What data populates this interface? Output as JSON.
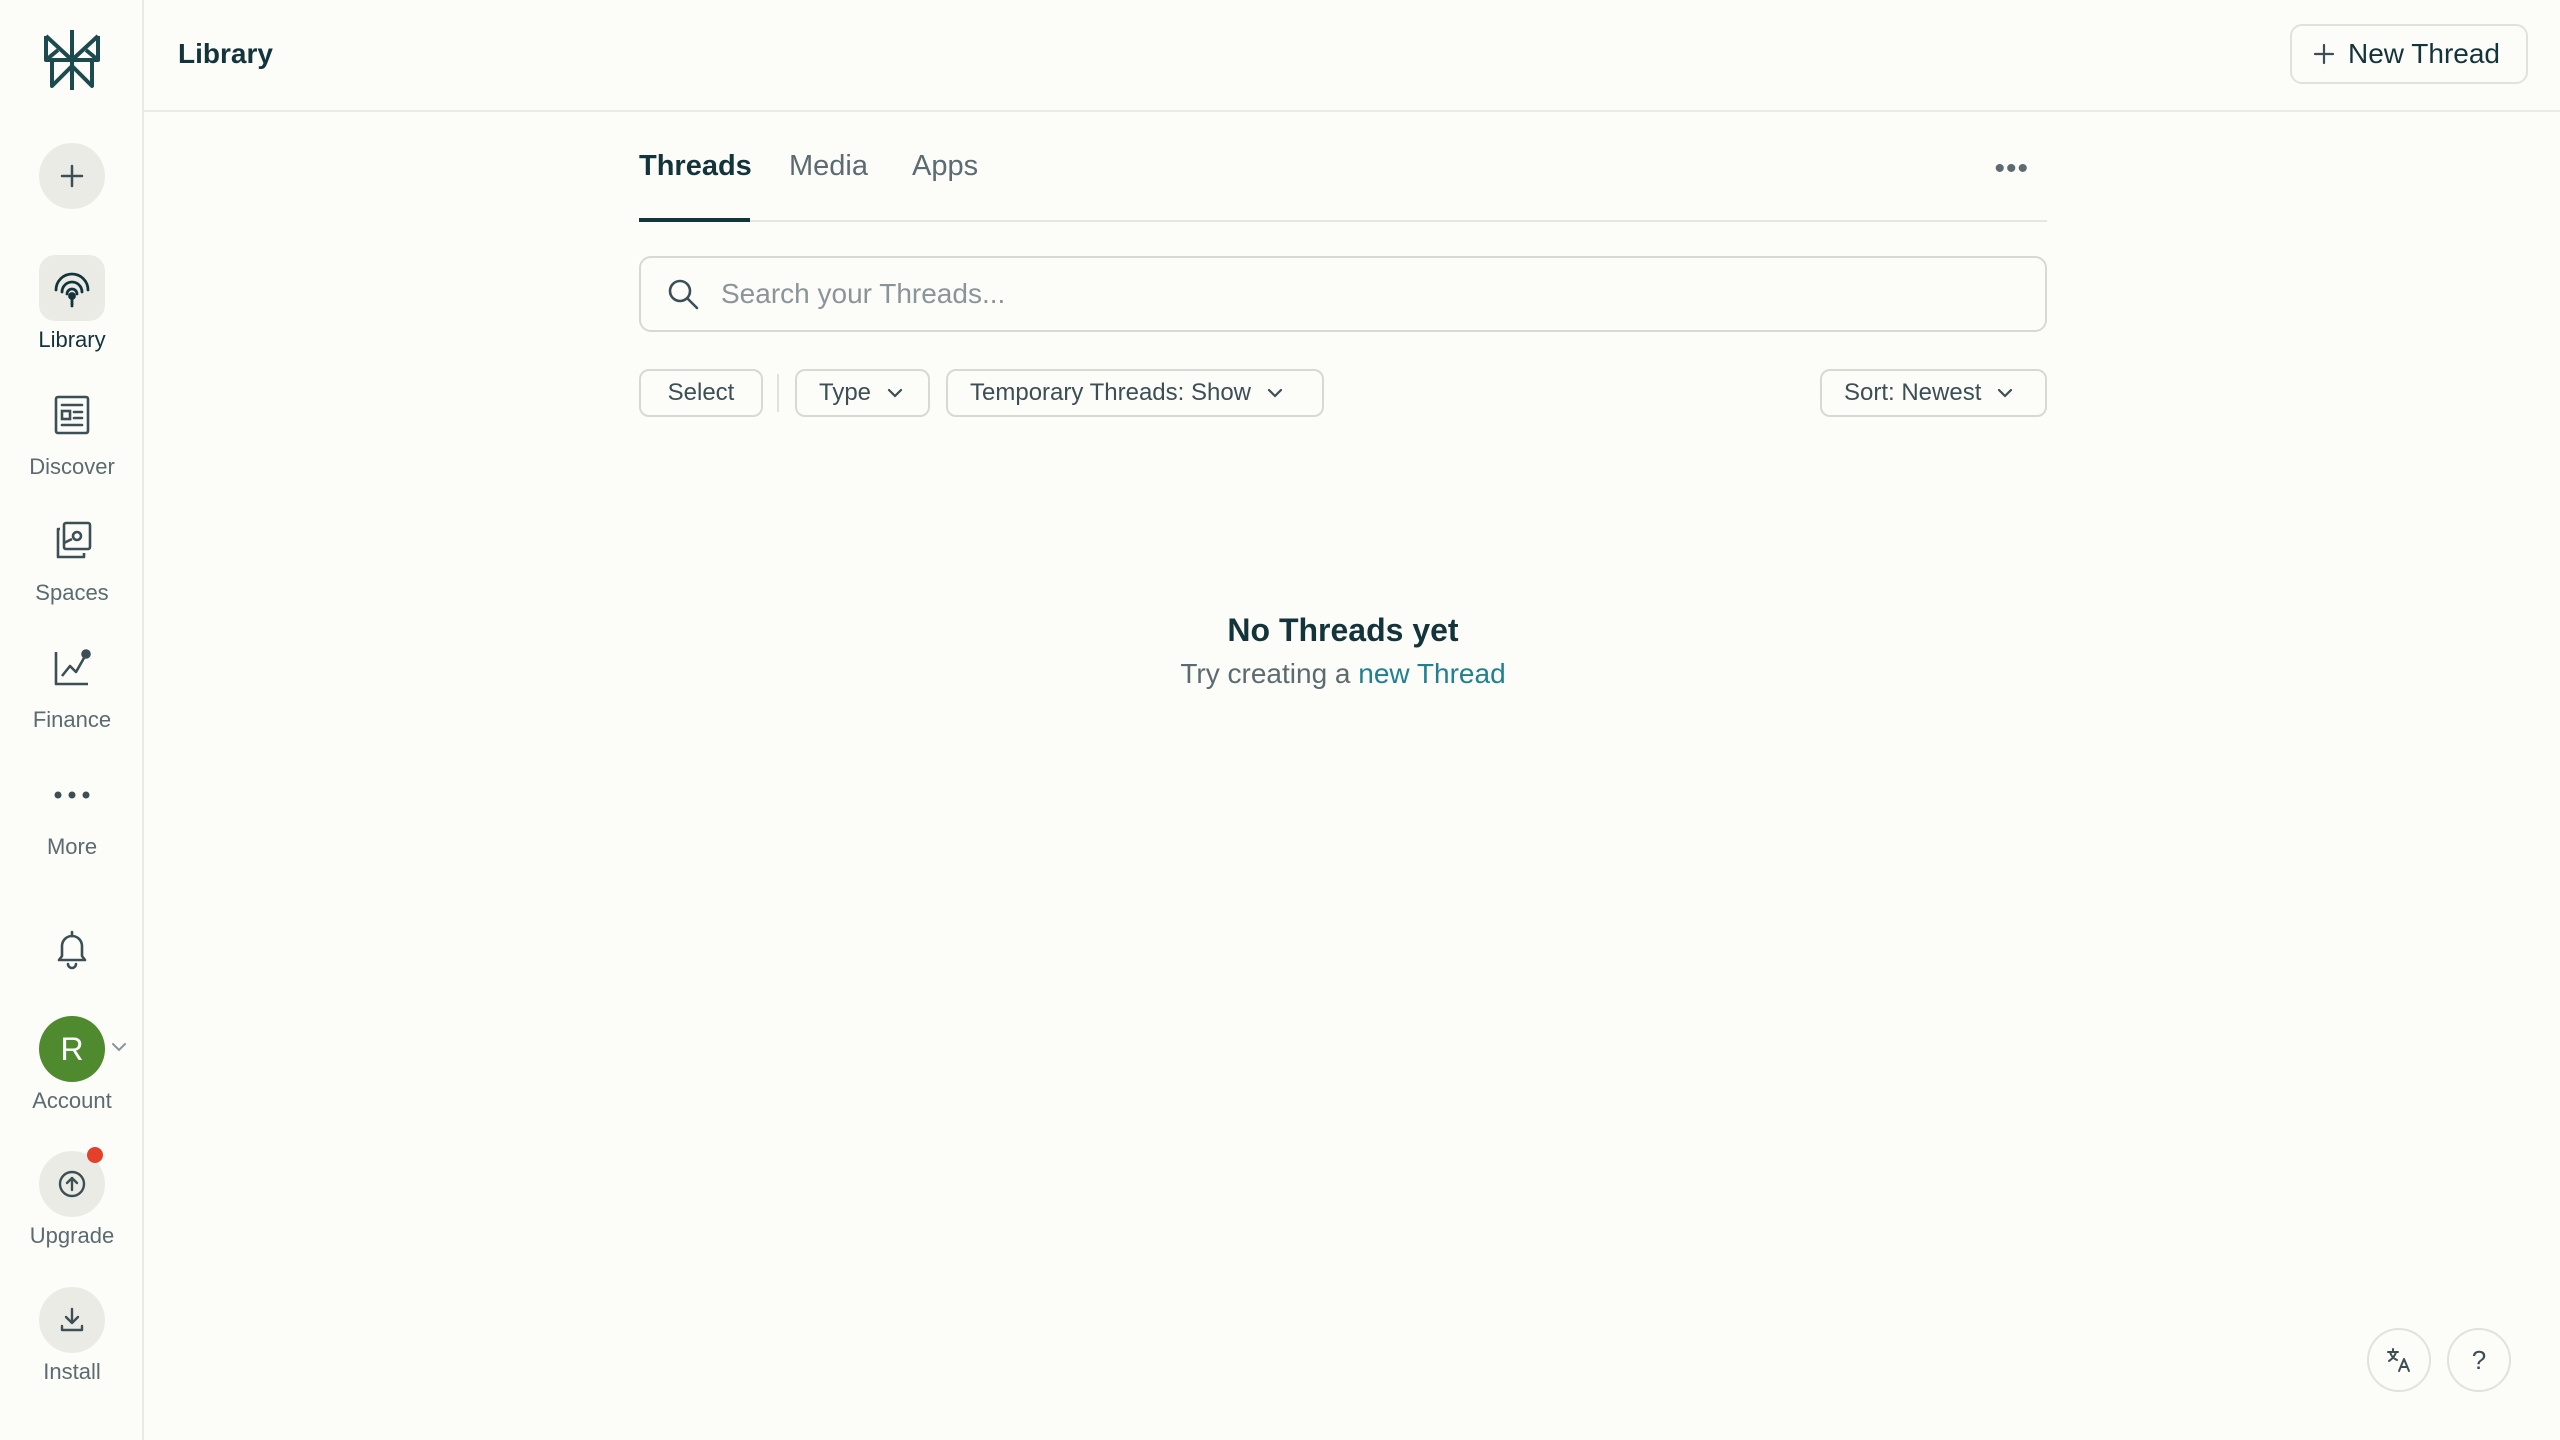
{
  "header": {
    "title": "Library",
    "new_thread_label": "New Thread"
  },
  "sidebar": {
    "items": [
      {
        "label": "Library",
        "icon": "library-icon",
        "active": true
      },
      {
        "label": "Discover",
        "icon": "discover-icon"
      },
      {
        "label": "Spaces",
        "icon": "spaces-icon"
      },
      {
        "label": "Finance",
        "icon": "finance-icon"
      },
      {
        "label": "More",
        "icon": "more-icon"
      }
    ],
    "account": {
      "initial": "R",
      "label": "Account"
    },
    "upgrade_label": "Upgrade",
    "install_label": "Install"
  },
  "tabs": [
    {
      "label": "Threads",
      "active": true
    },
    {
      "label": "Media"
    },
    {
      "label": "Apps"
    }
  ],
  "search": {
    "placeholder": "Search your Threads...",
    "value": ""
  },
  "filters": {
    "select_label": "Select",
    "type_label": "Type",
    "temporary_label": "Temporary Threads: Show",
    "sort_label": "Sort: Newest"
  },
  "empty_state": {
    "title": "No Threads yet",
    "subtitle_prefix": "Try creating a",
    "subtitle_link": "new Thread"
  },
  "corner": {
    "help_label": "?"
  },
  "colors": {
    "accent": "#20808d",
    "text": "#13343b",
    "avatar": "#4f8a2e",
    "notification": "#e5402a",
    "background": "#fcfcf9"
  }
}
